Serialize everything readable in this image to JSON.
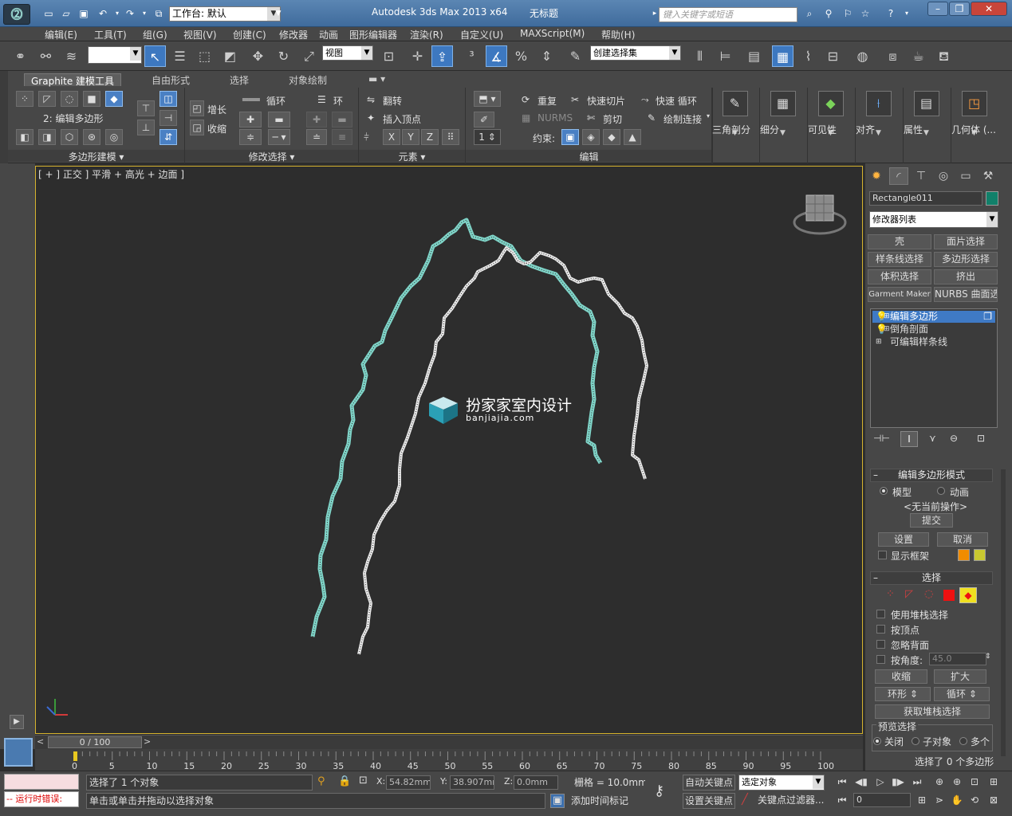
{
  "window": {
    "app_title": "Autodesk 3ds Max  2013 x64",
    "doc_title": "无标题",
    "workspace_label": "工作台: 默认",
    "search_placeholder": "键入关键字或短语",
    "app_icon": "3ds-max-logo-icon"
  },
  "menu": [
    "编辑(E)",
    "工具(T)",
    "组(G)",
    "视图(V)",
    "创建(C)",
    "修改器",
    "动画",
    "图形编辑器",
    "渲染(R)",
    "自定义(U)",
    "MAXScript(M)",
    "帮助(H)"
  ],
  "toolbar": {
    "ref_coord": "视图",
    "named_selection": "创建选择集"
  },
  "ribbon": {
    "tabs": [
      "Graphite 建模工具",
      "自由形式",
      "选择",
      "对象绘制"
    ],
    "stack_label": "2: 编辑多边形",
    "panels": {
      "polygon_modeling": "多边形建模",
      "modify_selection": "修改选择",
      "elements": "元素",
      "edit": "编辑"
    },
    "grow": "增长",
    "shrink": "收缩",
    "loop": "循环",
    "ring": "环",
    "flip": "翻转",
    "insert_vertex": "插入顶点",
    "repeat": "重复",
    "nurms": "NURMS",
    "quick_slice": "快速切片",
    "cut": "剪切",
    "quick_loop": "快速 循环",
    "paint_connect": "绘制连接",
    "constraints": "约束:",
    "axis_x": "X",
    "axis_y": "Y",
    "axis_z": "Z",
    "spinner_value": "1",
    "big_buttons": [
      "三角剖分",
      "细分",
      "可见性",
      "对齐",
      "属性",
      "几何体 (..."
    ]
  },
  "viewport": {
    "label": "[ + ] 正交 ] 平滑 + 高光 + 边面 ]",
    "watermark_cn": "扮家家室内设计",
    "watermark_en": "banjiajia.com"
  },
  "command_panel": {
    "object_name": "Rectangle011",
    "object_color": "#11806a",
    "modifier_list": "修改器列表",
    "mod_buttons": [
      "壳",
      "面片选择",
      "样条线选择",
      "多边形选择",
      "体积选择",
      "挤出",
      "Garment Maker",
      "NURBS 曲面选择"
    ],
    "stack": [
      "编辑多边形",
      "倒角剖面",
      "可编辑样条线"
    ],
    "edit_poly_mode": {
      "title": "编辑多边形模式",
      "model": "模型",
      "animate": "动画",
      "no_op": "<无当前操作>",
      "commit": "提交",
      "settings": "设置",
      "cancel": "取消",
      "show_cage": "显示框架",
      "cage_color1": "#f08c00",
      "cage_color2": "#c8c830"
    },
    "selection": {
      "title": "选择",
      "use_stack": "使用堆栈选择",
      "by_vertex": "按顶点",
      "ignore_back": "忽略背面",
      "by_angle": "按角度:",
      "angle_value": "45.0",
      "shrink": "收缩",
      "grow": "扩大",
      "ring": "环形",
      "loop": "循环",
      "get_stack": "获取堆栈选择",
      "preview": "预览选择",
      "off": "关闭",
      "subobj": "子对象",
      "multi": "多个",
      "status": "选择了 0 个多边形"
    }
  },
  "timeline": {
    "frame": "0 / 100",
    "ticks": [
      "0",
      "5",
      "10",
      "15",
      "20",
      "25",
      "30",
      "35",
      "40",
      "45",
      "50",
      "55",
      "60",
      "65",
      "70",
      "75",
      "80",
      "85",
      "90",
      "95",
      "100"
    ]
  },
  "status": {
    "error_label": "-- 运行时错误:",
    "selected": "选择了 1 个对象",
    "prompt": "单击或单击并拖动以选择对象",
    "x": "54.82mm",
    "y": "38.907mm",
    "z": "0.0mm",
    "grid": "栅格 = 10.0mm",
    "add_tag": "添加时间标记",
    "auto_key": "自动关键点",
    "set_key": "设置关键点",
    "selected_dd": "选定对象",
    "key_filter": "关键点过滤器...",
    "frame_field": "0"
  }
}
